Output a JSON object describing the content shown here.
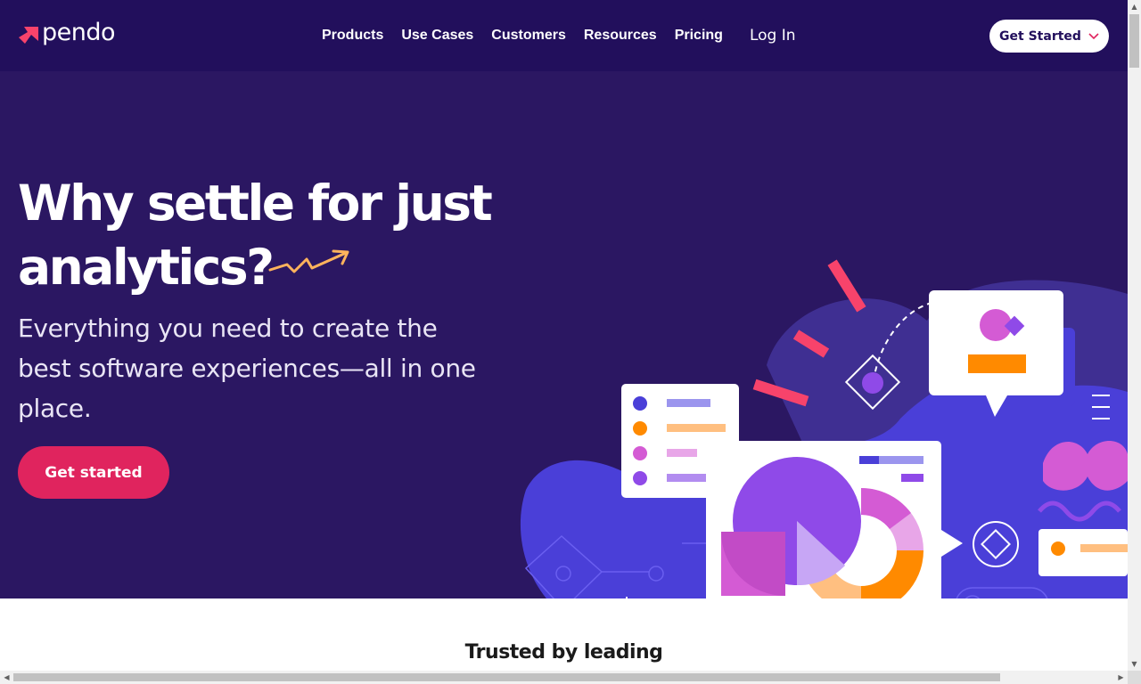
{
  "brand": {
    "name": "pendo",
    "logo_icon": "pendo-arrow-logo",
    "accent": "#f7436b"
  },
  "nav": {
    "links": [
      "Products",
      "Use Cases",
      "Customers",
      "Resources",
      "Pricing"
    ],
    "login": "Log In",
    "cta": {
      "label": "Get Started",
      "icon": "chevron-down-icon"
    }
  },
  "hero": {
    "headline_line1": "Why settle for just",
    "headline_line2": "analytics?",
    "subhead": "Everything you need to create the best software experiences—all in one place.",
    "cta": "Get started",
    "background": "#2b1762",
    "cta_color": "#e0245e"
  },
  "trusted": {
    "heading": "Trusted by leading"
  },
  "colors": {
    "nav_bg": "#220f5c",
    "blob": "#4a3fd8",
    "orange": "#ff8a00",
    "magenta": "#d45bd4",
    "purple": "#8f4ae8"
  }
}
